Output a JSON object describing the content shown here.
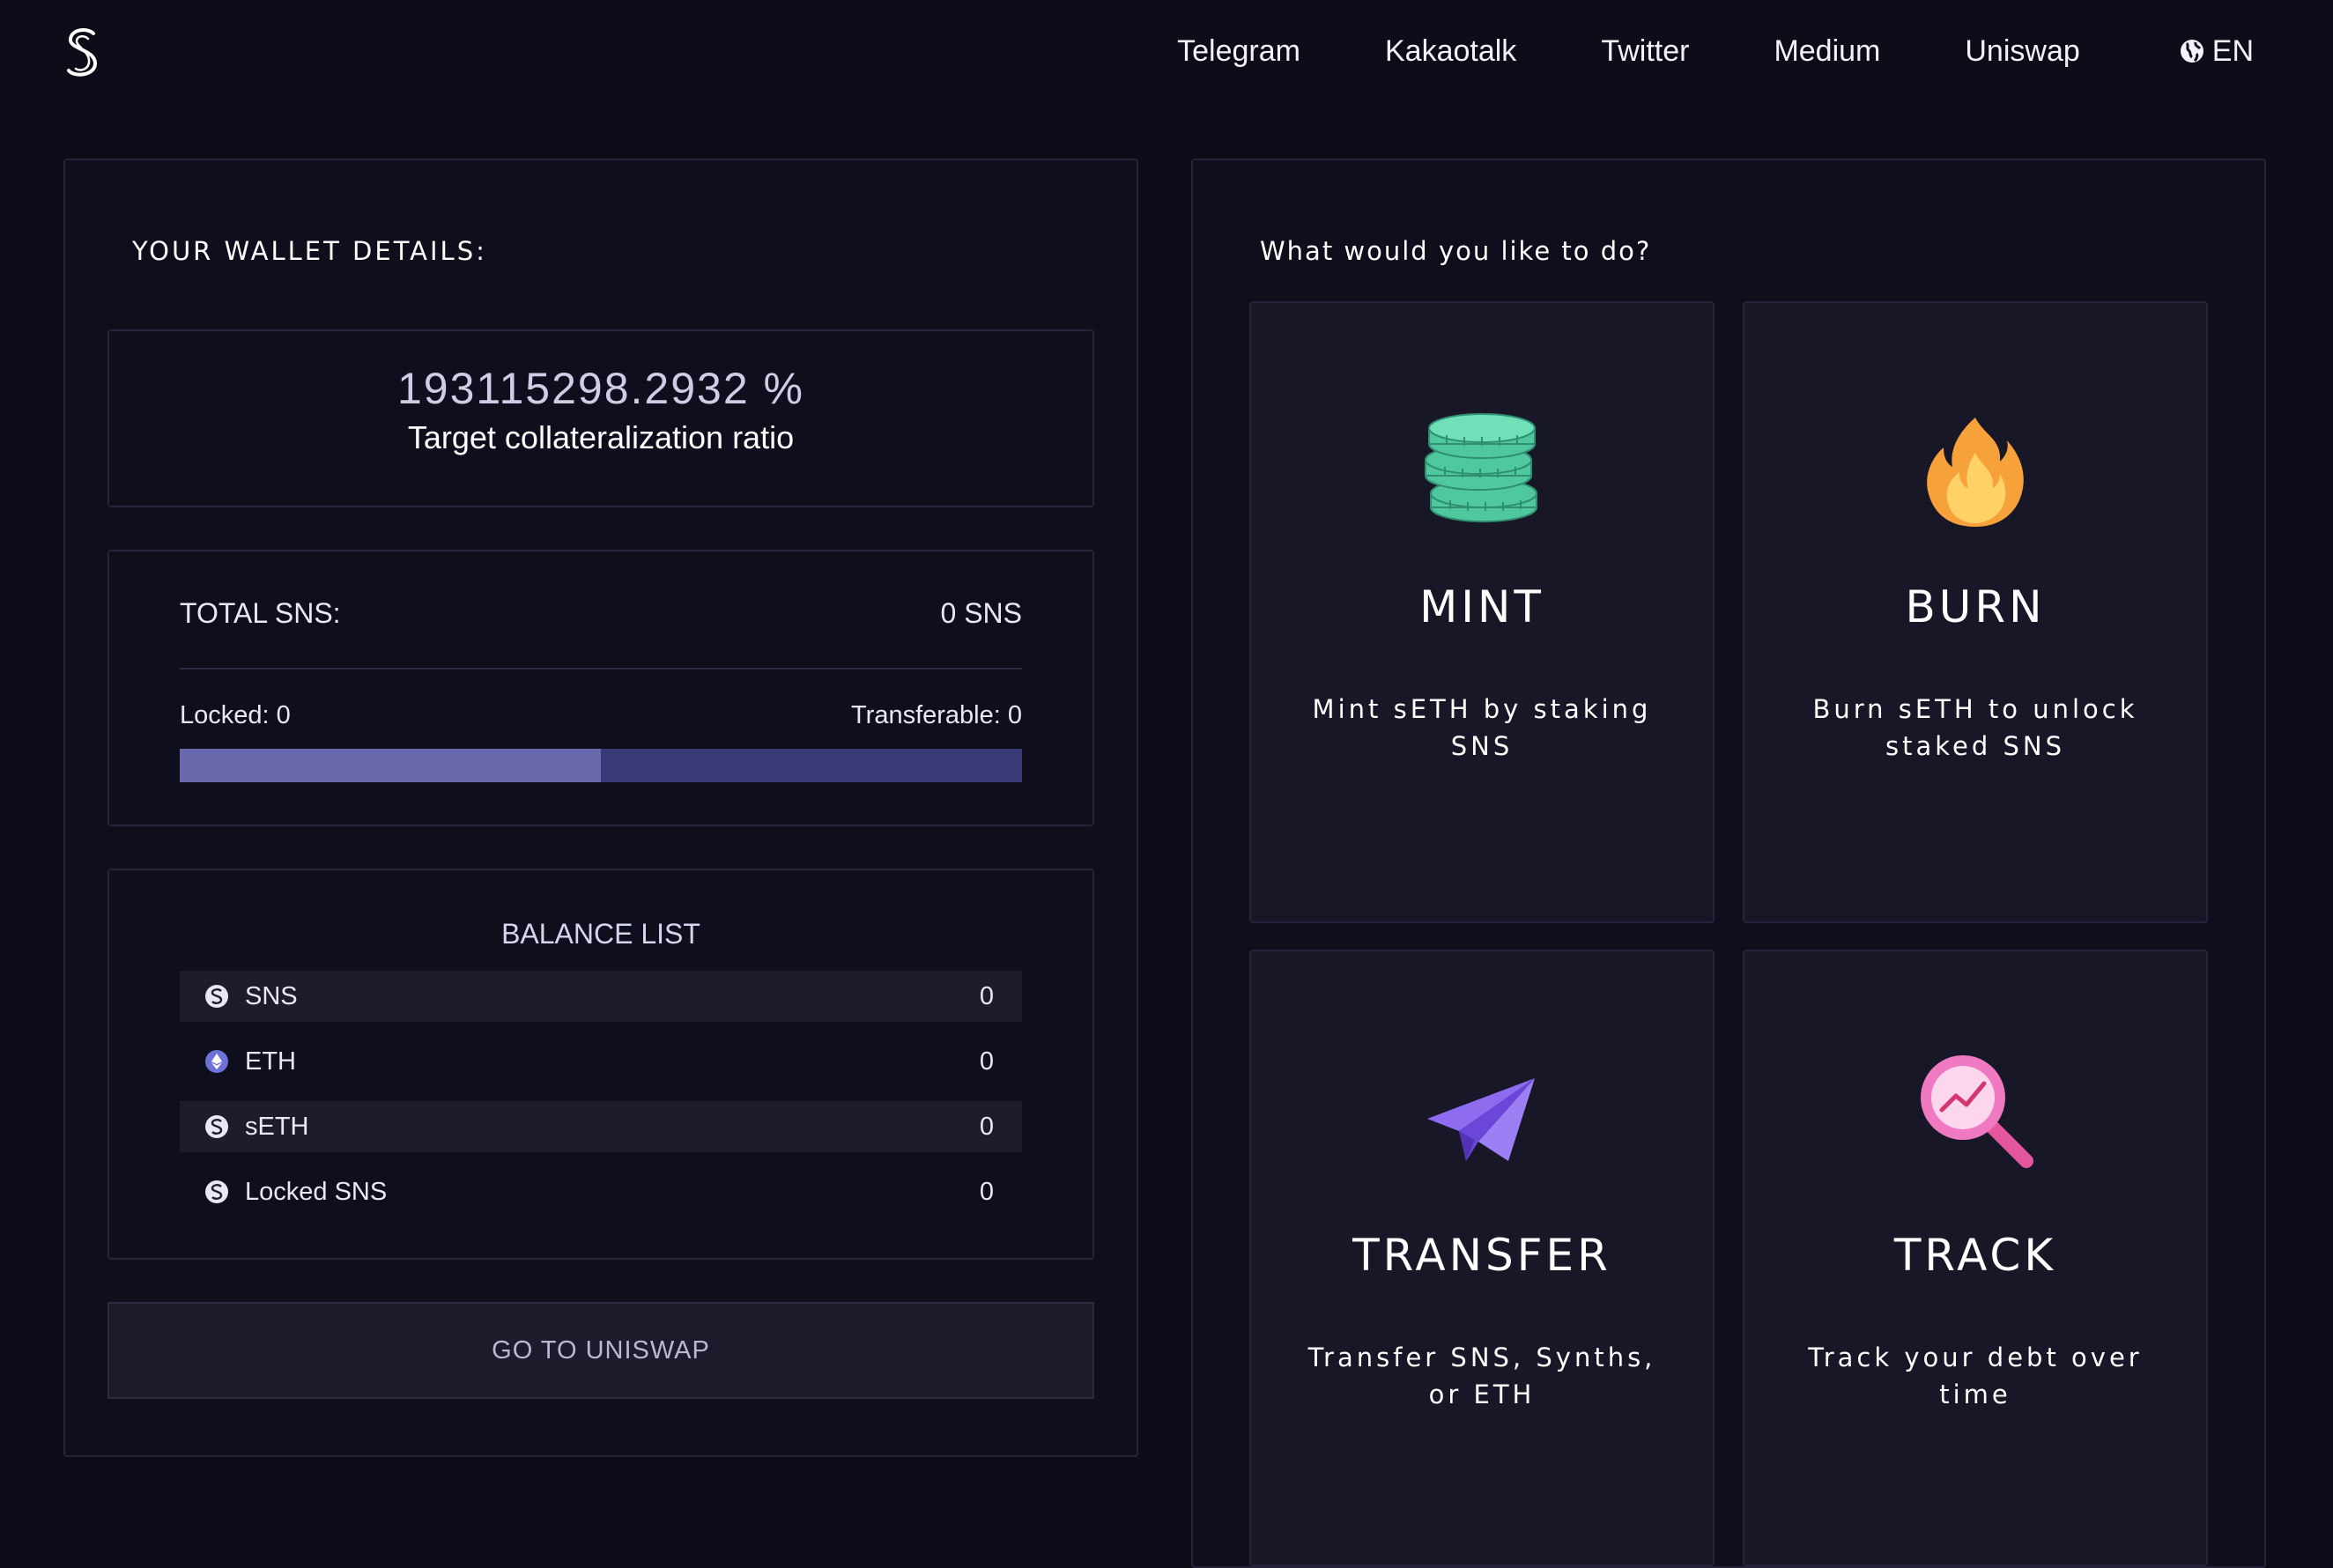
{
  "header": {
    "logo_icon": "synthetix-s-logo-icon",
    "nav": [
      "Telegram",
      "Kakaotalk",
      "Twitter",
      "Medium",
      "Uniswap"
    ],
    "language": "EN",
    "language_icon": "globe-icon"
  },
  "wallet": {
    "section_title": "YOUR WALLET DETAILS:",
    "ratio_value": "193115298.2932 %",
    "ratio_label": "Target collateralization ratio",
    "total_label": "TOTAL SNS:",
    "total_value": "0 SNS",
    "locked_label": "Locked: 0",
    "transferable_label": "Transferable: 0",
    "locked_fraction": 0.5,
    "balance_title": "BALANCE LIST",
    "balances": [
      {
        "name": "SNS",
        "value": "0",
        "icon": "sns-token-icon"
      },
      {
        "name": "ETH",
        "value": "0",
        "icon": "eth-token-icon"
      },
      {
        "name": "sETH",
        "value": "0",
        "icon": "seth-token-icon"
      },
      {
        "name": "Locked SNS",
        "value": "0",
        "icon": "sns-token-icon"
      }
    ],
    "uniswap_button": "GO TO UNISWAP"
  },
  "actions": {
    "question": "What would you like to do?",
    "items": [
      {
        "title": "MINT",
        "desc": "Mint sETH by staking SNS",
        "icon": "coins-icon"
      },
      {
        "title": "BURN",
        "desc": "Burn sETH to unlock staked SNS",
        "icon": "fire-icon"
      },
      {
        "title": "TRANSFER",
        "desc": "Transfer SNS, Synths, or ETH",
        "icon": "paper-plane-icon"
      },
      {
        "title": "TRACK",
        "desc": "Track your debt over time",
        "icon": "magnifier-chart-icon"
      }
    ]
  },
  "colors": {
    "background": "#0d0c19",
    "bar_locked": "#6a69ad",
    "bar_track": "#3b3a78",
    "accent_green": "#4fc8a0"
  }
}
